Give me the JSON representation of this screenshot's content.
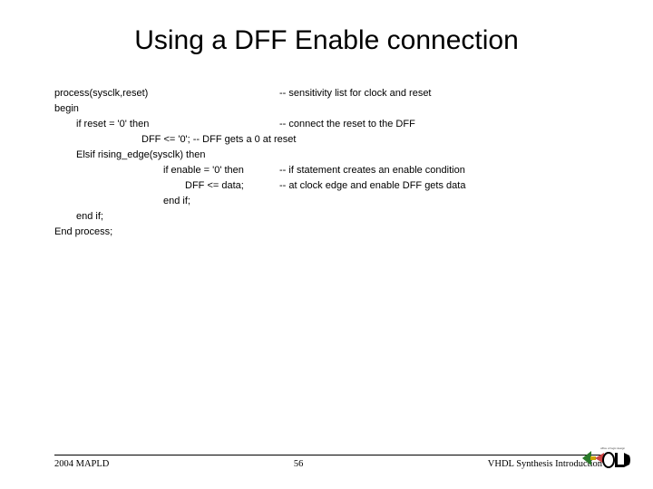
{
  "title": "Using a DFF Enable connection",
  "code": {
    "l1a": "process(sysclk,reset)",
    "l1b": "-- sensitivity list for clock and reset",
    "l2": "begin",
    "l3a": "if reset = '0' then",
    "l3b": "-- connect the reset to the DFF",
    "l4": "DFF <= '0';   -- DFF gets a 0 at reset",
    "l5": "Elsif rising_edge(sysclk) then",
    "l6a": "if enable = '0' then",
    "l6b": "-- if statement creates an enable condition",
    "l7a": "DFF <= data;",
    "l7b": "-- at clock edge and enable DFF gets data",
    "l8": "end if;",
    "l9": "end if;",
    "l10": "End process;"
  },
  "footer": {
    "left": "2004 MAPLD",
    "center": "56",
    "right": "VHDL Synthesis Introduction"
  }
}
